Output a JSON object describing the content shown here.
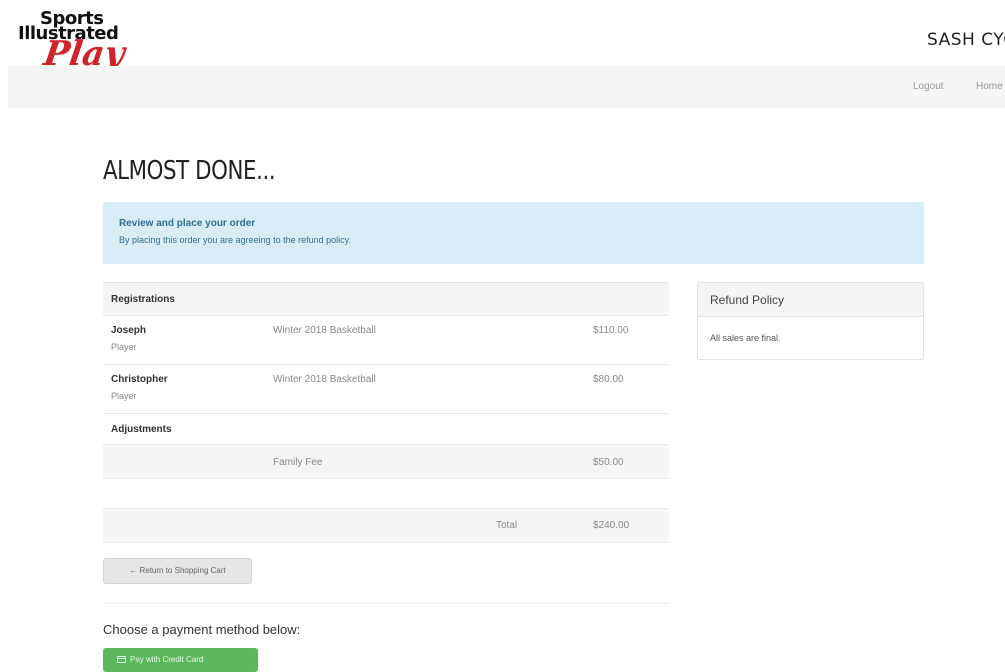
{
  "header": {
    "logo": {
      "line1": "Sports",
      "line2": "Illustrated",
      "line3": "Play"
    },
    "org_name": "SASH CYO",
    "nav": {
      "logout": "Logout",
      "home": "Home"
    }
  },
  "page_title": "ALMOST DONE...",
  "alert": {
    "title": "Review and place your order",
    "body": "By placing this order you are agreeing to the refund policy."
  },
  "order": {
    "registrations_header": "Registrations",
    "registrations": [
      {
        "name": "Joseph",
        "role": "Player",
        "program": "Winter 2018 Basketball",
        "amount": "$110.00"
      },
      {
        "name": "Christopher",
        "role": "Player",
        "program": "Winter 2018 Basketball",
        "amount": "$80.00"
      }
    ],
    "adjustments_header": "Adjustments",
    "adjustments": [
      {
        "label": "Family Fee",
        "amount": "$50.00"
      }
    ],
    "total_label": "Total",
    "total_amount": "$240.00"
  },
  "buttons": {
    "return_cart": "← Return to Shopping Cart",
    "pay_credit_card": "Pay with Credit Card"
  },
  "payment_prompt": "Choose a payment method below:",
  "refund_panel": {
    "title": "Refund Policy",
    "body": "All sales are final."
  },
  "colors": {
    "alert_bg": "#d9edf7",
    "alert_text": "#31708f",
    "pay_button": "#5cb85c",
    "logo_red": "#d2232a"
  }
}
